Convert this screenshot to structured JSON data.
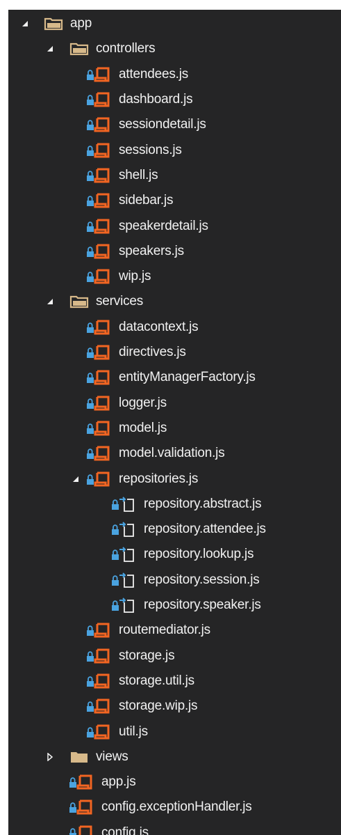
{
  "tree": [
    {
      "label": "app",
      "kind": "folder",
      "depth": 0,
      "expanded": true
    },
    {
      "label": "controllers",
      "kind": "folder",
      "depth": 1,
      "expanded": true
    },
    {
      "label": "attendees.js",
      "kind": "js",
      "depth": 2
    },
    {
      "label": "dashboard.js",
      "kind": "js",
      "depth": 2
    },
    {
      "label": "sessiondetail.js",
      "kind": "js",
      "depth": 2
    },
    {
      "label": "sessions.js",
      "kind": "js",
      "depth": 2
    },
    {
      "label": "shell.js",
      "kind": "js",
      "depth": 2
    },
    {
      "label": "sidebar.js",
      "kind": "js",
      "depth": 2
    },
    {
      "label": "speakerdetail.js",
      "kind": "js",
      "depth": 2
    },
    {
      "label": "speakers.js",
      "kind": "js",
      "depth": 2
    },
    {
      "label": "wip.js",
      "kind": "js",
      "depth": 2
    },
    {
      "label": "services",
      "kind": "folder",
      "depth": 1,
      "expanded": true
    },
    {
      "label": "datacontext.js",
      "kind": "js",
      "depth": 2
    },
    {
      "label": "directives.js",
      "kind": "js",
      "depth": 2
    },
    {
      "label": "entityManagerFactory.js",
      "kind": "js",
      "depth": 2
    },
    {
      "label": "logger.js",
      "kind": "js",
      "depth": 2
    },
    {
      "label": "model.js",
      "kind": "js",
      "depth": 2
    },
    {
      "label": "model.validation.js",
      "kind": "js",
      "depth": 2
    },
    {
      "label": "repositories.js",
      "kind": "js",
      "depth": 2,
      "expanded": true
    },
    {
      "label": "repository.abstract.js",
      "kind": "nested",
      "depth": 3
    },
    {
      "label": "repository.attendee.js",
      "kind": "nested",
      "depth": 3
    },
    {
      "label": "repository.lookup.js",
      "kind": "nested",
      "depth": 3
    },
    {
      "label": "repository.session.js",
      "kind": "nested",
      "depth": 3
    },
    {
      "label": "repository.speaker.js",
      "kind": "nested",
      "depth": 3
    },
    {
      "label": "routemediator.js",
      "kind": "js",
      "depth": 2
    },
    {
      "label": "storage.js",
      "kind": "js",
      "depth": 2
    },
    {
      "label": "storage.util.js",
      "kind": "js",
      "depth": 2
    },
    {
      "label": "storage.wip.js",
      "kind": "js",
      "depth": 2
    },
    {
      "label": "util.js",
      "kind": "js",
      "depth": 2
    },
    {
      "label": "views",
      "kind": "folder-closed",
      "depth": 1,
      "expanded": false
    },
    {
      "label": "app.js",
      "kind": "js",
      "depth": 1
    },
    {
      "label": "config.exceptionHandler.js",
      "kind": "js",
      "depth": 1
    },
    {
      "label": "config.js",
      "kind": "js",
      "depth": 1
    }
  ],
  "colors": {
    "background": "#252526",
    "text": "#f1f1f1",
    "js_icon": "#f26522",
    "lock_icon": "#4aa3e0",
    "folder_icon": "#d7b98a"
  },
  "icons": {
    "folder": "folder-open-icon",
    "folder-closed": "folder-closed-icon",
    "js": "js-file-icon",
    "nested": "nested-js-file-icon",
    "lock": "lock-icon"
  }
}
